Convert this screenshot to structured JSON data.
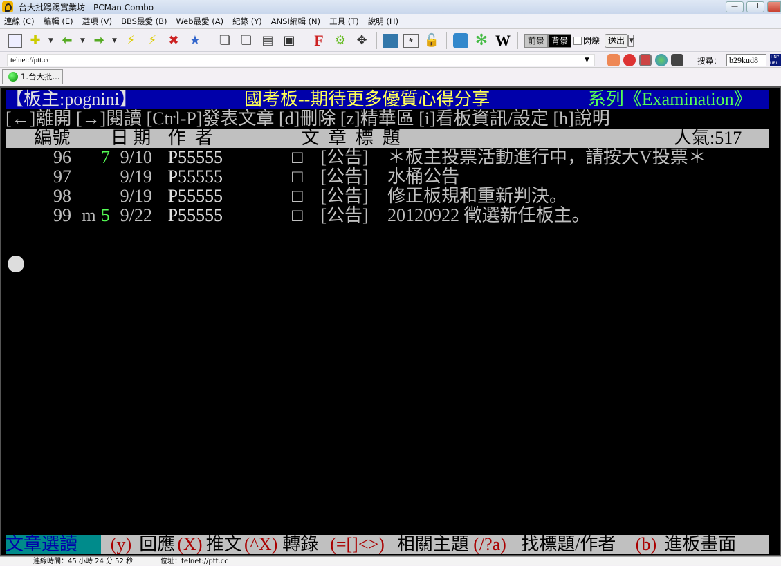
{
  "window": {
    "title": "台大批踢踢實業坊 - PCMan Combo"
  },
  "menu": [
    "連線 (C)",
    "編輯 (E)",
    "選項 (V)",
    "BBS最愛 (B)",
    "Web最愛 (A)",
    "紀錄 (Y)",
    "ANSI編輯 (N)",
    "工具 (T)",
    "說明 (H)"
  ],
  "toolbar": {
    "fg_label": "前景",
    "bg_label": "背景",
    "blink_label": "閃爍",
    "send_label": "送出",
    "wiki": "W",
    "f_icon": "F"
  },
  "address": {
    "value": "telnet://ptt.cc"
  },
  "search": {
    "label": "搜尋：",
    "value": "b29kud8",
    "tinyurl": "TINY URL"
  },
  "tabs": [
    {
      "label": "1.台大批..."
    }
  ],
  "colors": {
    "blue": "#0000aa",
    "yellow": "#ffff55",
    "green": "#55ff55",
    "gray": "#c0c0c0",
    "white": "#e0e0e0",
    "teal": "#008b8b",
    "darkred": "#aa0000"
  },
  "terminal": {
    "rows": [
      {
        "row": 0,
        "bg": "#0000aa",
        "bgfrom": 0,
        "bgto": 80,
        "segs": [
          {
            "col": 0,
            "text": "【板主:pognini】",
            "color": "#e0e0e0"
          },
          {
            "col": 25,
            "text": "國考板--期待更多優質心得分享",
            "color": "#ffff55"
          },
          {
            "col": 61,
            "text": "系列《Examination》",
            "color": "#55ff55"
          }
        ]
      },
      {
        "row": 1,
        "segs": [
          {
            "col": 0,
            "text": "[←]離開 [→]閱讀 [Ctrl-P]發表文章 [d]刪除 [z]精華區 [i]看板資訊/設定 [h]說明",
            "color": "#c0c0c0"
          }
        ]
      },
      {
        "row": 2,
        "bg": "#c0c0c0",
        "bgfrom": 0,
        "bgto": 80,
        "segs": [
          {
            "col": 3,
            "text": "編號",
            "color": "#000"
          },
          {
            "col": 11,
            "text": "日 期",
            "color": "#000"
          },
          {
            "col": 17,
            "text": "作  者",
            "color": "#000"
          },
          {
            "col": 31,
            "text": "文  章  標  題",
            "color": "#000"
          },
          {
            "col": 70,
            "text": "人氣:517",
            "color": "#000"
          }
        ]
      },
      {
        "row": 3,
        "segs": [
          {
            "col": 5,
            "text": "96",
            "color": "#c0c0c0"
          },
          {
            "col": 10,
            "text": "7",
            "color": "#55ff55"
          },
          {
            "col": 12,
            "text": "9/10",
            "color": "#c0c0c0"
          },
          {
            "col": 17,
            "text": "P55555",
            "color": "#e0e0e0"
          },
          {
            "col": 30,
            "text": "□",
            "color": "#c0c0c0"
          },
          {
            "col": 33,
            "text": "[公告]",
            "color": "#c0c0c0"
          },
          {
            "col": 40,
            "text": "＊板主投票活動進行中，請按大V投票＊",
            "color": "#c0c0c0"
          }
        ]
      },
      {
        "row": 4,
        "segs": [
          {
            "col": 5,
            "text": "97",
            "color": "#c0c0c0"
          },
          {
            "col": 12,
            "text": "9/19",
            "color": "#c0c0c0"
          },
          {
            "col": 17,
            "text": "P55555",
            "color": "#e0e0e0"
          },
          {
            "col": 30,
            "text": "□",
            "color": "#c0c0c0"
          },
          {
            "col": 33,
            "text": "[公告]",
            "color": "#c0c0c0"
          },
          {
            "col": 40,
            "text": "水桶公告",
            "color": "#c0c0c0"
          }
        ]
      },
      {
        "row": 5,
        "segs": [
          {
            "col": 5,
            "text": "98",
            "color": "#c0c0c0"
          },
          {
            "col": 12,
            "text": "9/19",
            "color": "#c0c0c0"
          },
          {
            "col": 17,
            "text": "P55555",
            "color": "#e0e0e0"
          },
          {
            "col": 30,
            "text": "□",
            "color": "#c0c0c0"
          },
          {
            "col": 33,
            "text": "[公告]",
            "color": "#c0c0c0"
          },
          {
            "col": 40,
            "text": "修正板規和重新判決。",
            "color": "#c0c0c0"
          }
        ]
      },
      {
        "row": 6,
        "segs": [
          {
            "col": 5,
            "text": "99",
            "color": "#c0c0c0"
          },
          {
            "col": 8,
            "text": "m",
            "color": "#c0c0c0"
          },
          {
            "col": 10,
            "text": "5",
            "color": "#55ff55"
          },
          {
            "col": 12,
            "text": "9/22",
            "color": "#c0c0c0"
          },
          {
            "col": 17,
            "text": "P55555",
            "color": "#e0e0e0"
          },
          {
            "col": 30,
            "text": "□",
            "color": "#c0c0c0"
          },
          {
            "col": 33,
            "text": "[公告]",
            "color": "#c0c0c0"
          },
          {
            "col": 40,
            "text": "20120922 徵選新任板主。",
            "color": "#c0c0c0"
          }
        ]
      }
    ],
    "footer": {
      "bg": "#c0c0c0",
      "segs": [
        {
          "col": 0,
          "text": "文章選讀",
          "color": "#0000aa",
          "bg": "#008b8b",
          "w": 10
        },
        {
          "col": 11,
          "text": "(y)",
          "color": "#aa0000"
        },
        {
          "col": 14,
          "text": "回應",
          "color": "#000"
        },
        {
          "col": 18,
          "text": "(X)",
          "color": "#aa0000"
        },
        {
          "col": 21,
          "text": "推文",
          "color": "#000"
        },
        {
          "col": 25,
          "text": "(^X)",
          "color": "#aa0000"
        },
        {
          "col": 29,
          "text": "轉錄",
          "color": "#000"
        },
        {
          "col": 34,
          "text": "(=[]<>)",
          "color": "#aa0000"
        },
        {
          "col": 41,
          "text": "相關主題",
          "color": "#000"
        },
        {
          "col": 49,
          "text": "(/?a)",
          "color": "#aa0000"
        },
        {
          "col": 54,
          "text": "找標題/作者",
          "color": "#000"
        },
        {
          "col": 66,
          "text": "(b)",
          "color": "#aa0000"
        },
        {
          "col": 69,
          "text": "進板畫面",
          "color": "#000"
        }
      ]
    }
  },
  "status": {
    "conn_time": "連線時間：45 小時 24 分 52 秒",
    "address": "位址：telnet://ptt.cc"
  }
}
